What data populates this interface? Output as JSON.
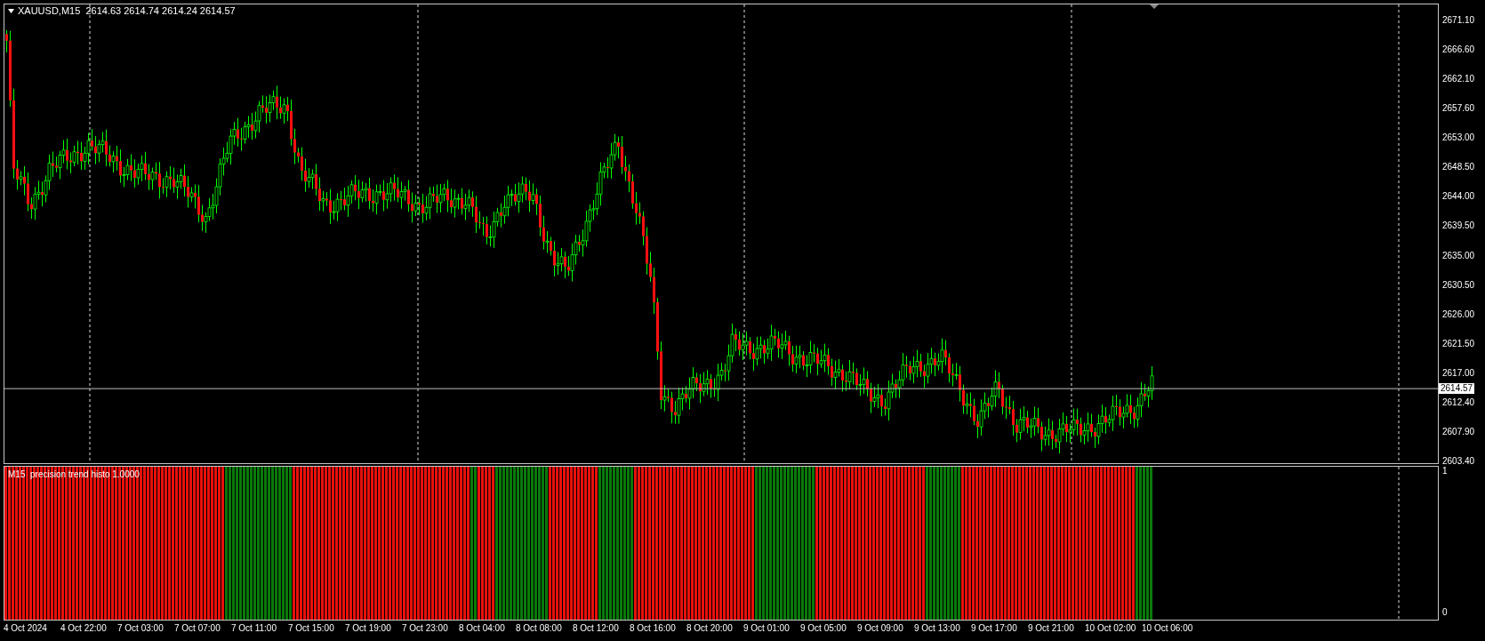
{
  "chart": {
    "symbol_line": "XAUUSD,M15  2614.63 2614.74 2614.24 2614.57",
    "current_price": "2614.57",
    "price_labels": [
      "2671.10",
      "2666.60",
      "2662.10",
      "2657.60",
      "2653.00",
      "2648.50",
      "2644.00",
      "2639.50",
      "2635.00",
      "2630.50",
      "2626.00",
      "2621.50",
      "2617.00",
      "2612.40",
      "2607.90",
      "2603.40"
    ]
  },
  "indicator": {
    "label": "M15  precision trend histo 1.0000",
    "scale_labels": [
      "1",
      "0"
    ]
  },
  "time_labels": [
    "4 Oct 2024",
    "4 Oct 22:00",
    "7 Oct 03:00",
    "7 Oct 07:00",
    "7 Oct 11:00",
    "7 Oct 15:00",
    "7 Oct 19:00",
    "7 Oct 23:00",
    "8 Oct 04:00",
    "8 Oct 08:00",
    "8 Oct 12:00",
    "8 Oct 16:00",
    "8 Oct 20:00",
    "9 Oct 01:00",
    "9 Oct 05:00",
    "9 Oct 09:00",
    "9 Oct 13:00",
    "9 Oct 17:00",
    "9 Oct 21:00",
    "10 Oct 02:00",
    "10 Oct 06:00"
  ]
}
